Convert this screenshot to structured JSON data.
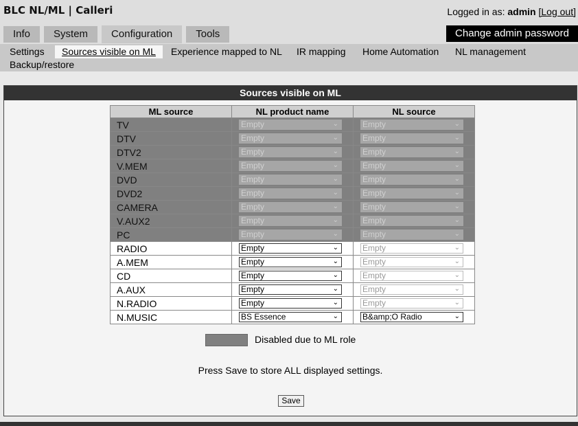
{
  "header": {
    "title": "BLC NL/ML | Calleri",
    "login_prefix": "Logged in as: ",
    "user": "admin",
    "logout_label": "[Log out]",
    "admin_button": "Change admin password"
  },
  "tabs": [
    "Info",
    "System",
    "Configuration",
    "Tools"
  ],
  "active_tab": "Configuration",
  "subnav": {
    "items": [
      "Settings",
      "Sources visible on ML",
      "Experience mapped to NL",
      "IR mapping",
      "Home Automation",
      "NL management",
      "Backup/restore"
    ],
    "active": "Sources visible on ML"
  },
  "panel": {
    "title": "Sources visible on ML",
    "columns": [
      "ML source",
      "NL product name",
      "NL source"
    ],
    "rows": [
      {
        "source": "TV",
        "product": "Empty",
        "nl_source": "Empty",
        "disabled": true
      },
      {
        "source": "DTV",
        "product": "Empty",
        "nl_source": "Empty",
        "disabled": true
      },
      {
        "source": "DTV2",
        "product": "Empty",
        "nl_source": "Empty",
        "disabled": true
      },
      {
        "source": "V.MEM",
        "product": "Empty",
        "nl_source": "Empty",
        "disabled": true
      },
      {
        "source": "DVD",
        "product": "Empty",
        "nl_source": "Empty",
        "disabled": true
      },
      {
        "source": "DVD2",
        "product": "Empty",
        "nl_source": "Empty",
        "disabled": true
      },
      {
        "source": "CAMERA",
        "product": "Empty",
        "nl_source": "Empty",
        "disabled": true
      },
      {
        "source": "V.AUX2",
        "product": "Empty",
        "nl_source": "Empty",
        "disabled": true
      },
      {
        "source": "PC",
        "product": "Empty",
        "nl_source": "Empty",
        "disabled": true
      },
      {
        "source": "RADIO",
        "product": "Empty",
        "nl_source": "Empty",
        "disabled": false
      },
      {
        "source": "A.MEM",
        "product": "Empty",
        "nl_source": "Empty",
        "disabled": false
      },
      {
        "source": "CD",
        "product": "Empty",
        "nl_source": "Empty",
        "disabled": false
      },
      {
        "source": "A.AUX",
        "product": "Empty",
        "nl_source": "Empty",
        "disabled": false
      },
      {
        "source": "N.RADIO",
        "product": "Empty",
        "nl_source": "Empty",
        "disabled": false
      },
      {
        "source": "N.MUSIC",
        "product": "BS Essence",
        "nl_source": "B&amp;O Radio",
        "disabled": false,
        "nl_source_enabled": true
      }
    ],
    "legend": "Disabled due to ML role",
    "info": "Press Save to store ALL displayed settings.",
    "save_label": "Save"
  },
  "colors": {
    "disabled_row": "#808080",
    "header_bar": "#333333",
    "admin_button_bg": "#000000"
  }
}
